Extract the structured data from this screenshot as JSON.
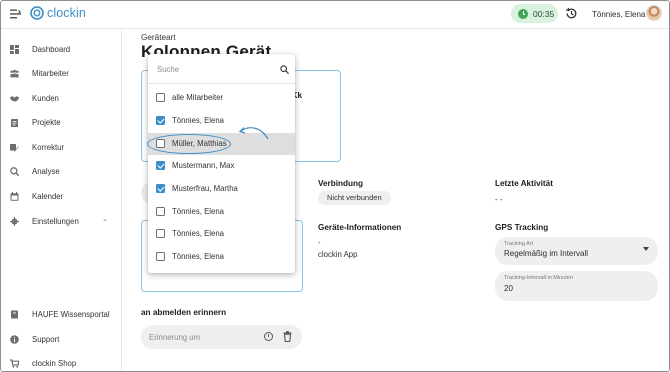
{
  "app": {
    "name": "clockin"
  },
  "topbar": {
    "timer": "00:35",
    "user_name": "Tönnies, Elena"
  },
  "sidebar": {
    "items": [
      {
        "label": "Dashboard",
        "icon": "dashboard-icon"
      },
      {
        "label": "Mitarbeiter",
        "icon": "users-icon"
      },
      {
        "label": "Kunden",
        "icon": "handshake-icon"
      },
      {
        "label": "Projekte",
        "icon": "clipboard-icon"
      },
      {
        "label": "Korrektur",
        "icon": "correction-icon"
      },
      {
        "label": "Analyse",
        "icon": "analytics-icon"
      },
      {
        "label": "Kalender",
        "icon": "calendar-icon"
      },
      {
        "label": "Einstellungen",
        "icon": "gear-icon"
      }
    ],
    "bottom": [
      {
        "label": "HAUFE Wissensportal",
        "icon": "book-icon"
      },
      {
        "label": "Support",
        "icon": "info-icon"
      },
      {
        "label": "clockin Shop",
        "icon": "cart-icon"
      }
    ]
  },
  "page": {
    "subtitle": "Geräteart",
    "title": "Kolonnen Gerät",
    "card1": {
      "line1": "en",
      "line2": "qEDRmKk",
      "link": "enerieren"
    }
  },
  "connection": {
    "label": "Verbindung",
    "status": "Nicht verbunden"
  },
  "last_activity": {
    "label": "Letzte Aktivität",
    "value": "- -"
  },
  "device_info": {
    "label": "Geräte-Informationen",
    "line1": "-",
    "line2": "clockin App"
  },
  "gps": {
    "label": "GPS Tracking",
    "tracking_type_label": "Tracking Art",
    "tracking_type_value": "Regelmäßig im Intervall",
    "interval_label": "Tracking-Intervall in Minuten",
    "interval_value": "20"
  },
  "reminder": {
    "label": "an abmelden erinnern",
    "placeholder": "Erinnerung um"
  },
  "dropdown": {
    "search_placeholder": "Suche",
    "items": [
      {
        "label": "alle Mitarbeiter",
        "checked": false
      },
      {
        "label": "Tönnies, Elena",
        "checked": true
      },
      {
        "label": "Müller, Matthias",
        "checked": false,
        "highlighted": true
      },
      {
        "label": "Mustermann, Max",
        "checked": true
      },
      {
        "label": "Musterfrau, Martha",
        "checked": true
      },
      {
        "label": "Tönnies, Elena",
        "checked": false
      },
      {
        "label": "Tönnies, Elena",
        "checked": false
      },
      {
        "label": "Tönnies, Elena",
        "checked": false
      }
    ]
  },
  "colors": {
    "accent": "#3a8fc8",
    "timer_bg": "#d8f2df",
    "timer_icon": "#3fa55a"
  }
}
